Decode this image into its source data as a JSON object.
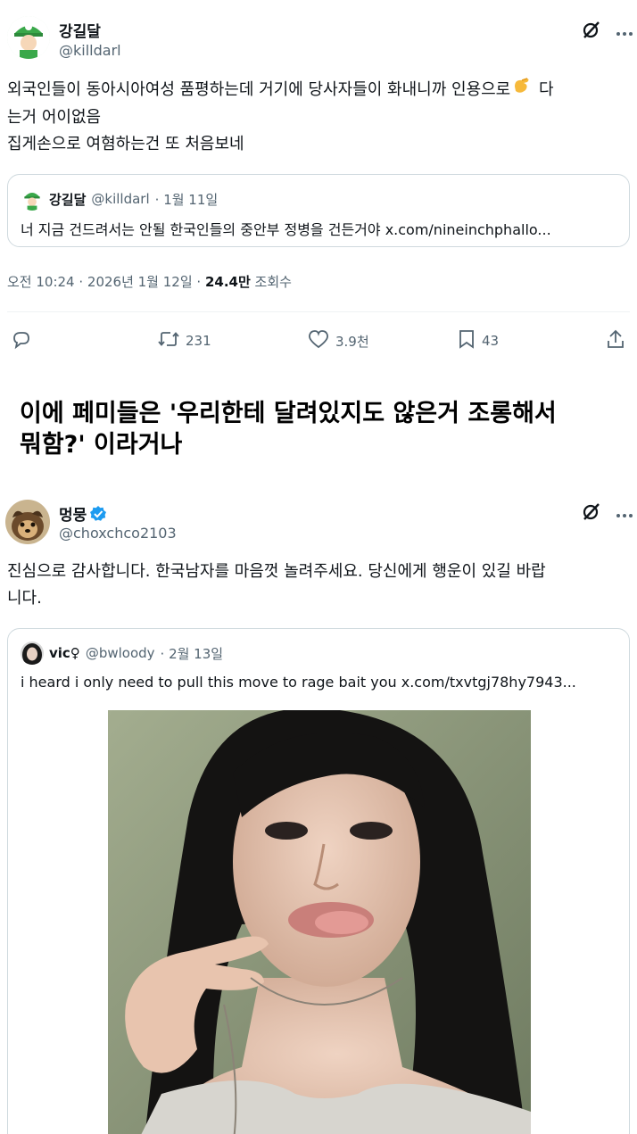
{
  "tweet1": {
    "display_name": "강길달",
    "handle": "@killdarl",
    "text_line1": "외국인들이 동아시아여성 품평하는데 거기에 당사자들이 화내니까 인용으로",
    "text_line1_tail": " 다",
    "text_line2": "는거 어이없음",
    "text_line3": "집게손으로 여혐하는건 또 처음보네",
    "quote": {
      "display_name": "강길달",
      "handle": "@killdarl",
      "date": "· 1월 11일",
      "text": "너 지금 건드려서는 안될 한국인들의 중안부 정병을 건든거야 x.com/nineinchphallo..."
    },
    "timestamp": "오전 10:24 · 2026년 1월 12일 · ",
    "views": "24.4만",
    "views_label": " 조회수",
    "actions": {
      "reply": "",
      "retweets": "231",
      "likes": "3.9천",
      "bookmarks": "43"
    }
  },
  "caption": {
    "line1": "이에 페미들은 '우리한테 달려있지도 않은거 조롱해서",
    "line2": "뭐함?' 이라거나"
  },
  "tweet2": {
    "display_name": "멍뭉",
    "handle": "@choxchco2103",
    "text_line1": "진심으로 감사합니다. 한국남자를 마음껏 놀려주세요. 당신에게 행운이 있길 바랍",
    "text_line2": "니다.",
    "quote": {
      "display_name": "vic♀",
      "handle": "@bwloody",
      "date": "· 2월 13일",
      "text": "i heard i only need to pull this move to rage bait you  x.com/txvtgj78hy7943..."
    }
  },
  "colors": {
    "text": "#0f1419",
    "muted": "#536471",
    "border": "#cfd9de",
    "verified": "#1d9bf0",
    "grok_icon": "#0f1419"
  },
  "icons": [
    "grok-icon",
    "more-icon",
    "reply-icon",
    "retweet-icon",
    "like-icon",
    "bookmark-icon",
    "share-icon",
    "verified-badge-icon",
    "pinch-emoji-icon"
  ]
}
